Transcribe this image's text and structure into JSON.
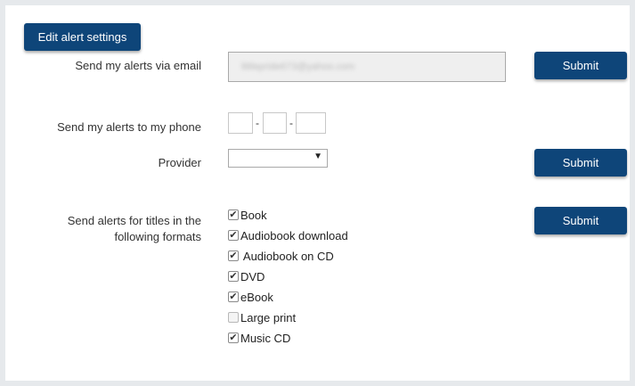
{
  "header": {
    "edit_button": "Edit alert settings"
  },
  "email": {
    "label": "Send my alerts via email",
    "value": "littlepride673@yahoo.com",
    "submit": "Submit"
  },
  "phone": {
    "label": "Send my alerts to my phone",
    "separator": "-",
    "provider_label": "Provider",
    "provider_value": "",
    "submit": "Submit"
  },
  "formats": {
    "label_line1": "Send alerts for titles in the",
    "label_line2": "following formats",
    "submit": "Submit",
    "items": [
      {
        "label": "Book",
        "checked": true
      },
      {
        "label": "Audiobook download",
        "checked": true
      },
      {
        "label": " Audiobook on CD",
        "checked": true
      },
      {
        "label": "DVD",
        "checked": true
      },
      {
        "label": "eBook",
        "checked": true
      },
      {
        "label": "Large print",
        "checked": false
      },
      {
        "label": "Music CD",
        "checked": true
      }
    ]
  },
  "colors": {
    "primary": "#0e4579",
    "background": "#e6e9ec"
  }
}
